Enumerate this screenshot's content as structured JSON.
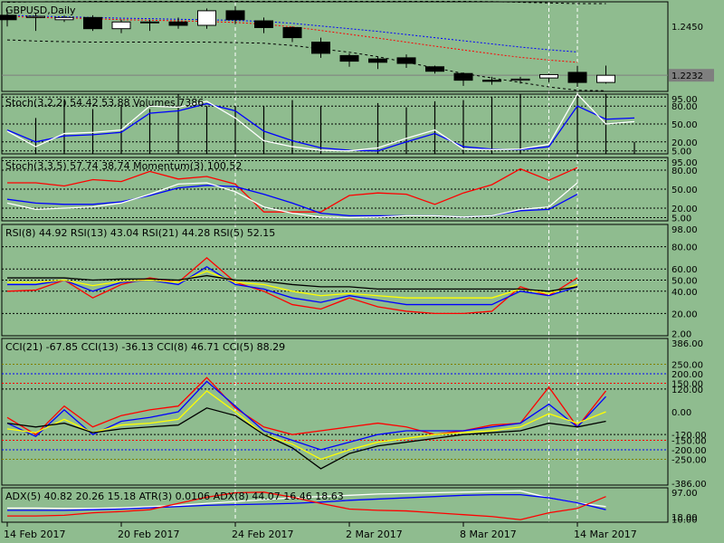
{
  "window": {
    "symbol_label": "GBPUSD,Daily",
    "last_price_label": "1.2232"
  },
  "x_labels": [
    {
      "bar": 0,
      "text": "14 Feb 2017"
    },
    {
      "bar": 4,
      "text": "20 Feb 2017"
    },
    {
      "bar": 8,
      "text": "24 Feb 2017"
    },
    {
      "bar": 12,
      "text": "2 Mar 2017"
    },
    {
      "bar": 16,
      "text": "8 Mar 2017"
    },
    {
      "bar": 20,
      "text": "14 Mar 2017"
    }
  ],
  "vlines_bars": [
    8,
    19,
    20
  ],
  "colors": {
    "background": "#8fbc8f",
    "bull": "#ffffff",
    "bear": "#000000",
    "red": "#ff0000",
    "blue": "#0000ff",
    "white": "#ffffff",
    "yellow": "#ffff00",
    "black": "#000000"
  },
  "chart_data": [
    {
      "type": "candlestick",
      "panel": "price",
      "ylim": [
        1.216,
        1.256
      ],
      "yticks": [
        "1.2450",
        "1.2232"
      ],
      "ohlc": [
        [
          1.25,
          1.2525,
          1.245,
          1.248
        ],
        [
          1.249,
          1.251,
          1.243,
          1.2495
        ],
        [
          1.248,
          1.25,
          1.247,
          1.249
        ],
        [
          1.249,
          1.25,
          1.243,
          1.244
        ],
        [
          1.244,
          1.248,
          1.242,
          1.247
        ],
        [
          1.247,
          1.248,
          1.243,
          1.247
        ],
        [
          1.247,
          1.249,
          1.244,
          1.2455
        ],
        [
          1.2455,
          1.253,
          1.244,
          1.252
        ],
        [
          1.252,
          1.254,
          1.246,
          1.248
        ],
        [
          1.2475,
          1.249,
          1.242,
          1.2445
        ],
        [
          1.2445,
          1.245,
          1.238,
          1.24
        ],
        [
          1.238,
          1.24,
          1.231,
          1.233
        ],
        [
          1.232,
          1.233,
          1.227,
          1.2295
        ],
        [
          1.2305,
          1.2315,
          1.226,
          1.229
        ],
        [
          1.231,
          1.2325,
          1.2265,
          1.2285
        ],
        [
          1.227,
          1.2275,
          1.224,
          1.225
        ],
        [
          1.224,
          1.2245,
          1.2185,
          1.221
        ],
        [
          1.221,
          1.2225,
          1.219,
          1.2205
        ],
        [
          1.221,
          1.2225,
          1.2195,
          1.2215
        ],
        [
          1.222,
          1.224,
          1.22,
          1.2235
        ],
        [
          1.2245,
          1.2275,
          1.218,
          1.22
        ],
        [
          1.22,
          1.2275,
          1.2195,
          1.2232
        ]
      ],
      "upper_band": [
        1.2558,
        1.256,
        1.2561,
        1.2562,
        1.2562,
        1.2562,
        1.2562,
        1.2562,
        1.2562,
        1.2562,
        1.2562,
        1.2562,
        1.2562,
        1.2562,
        1.2562,
        1.2562,
        1.2562,
        1.2561,
        1.2558,
        1.2555,
        1.2552,
        1.2552
      ],
      "lower_band": [
        1.239,
        1.2385,
        1.2382,
        1.238,
        1.238,
        1.238,
        1.238,
        1.238,
        1.2378,
        1.2375,
        1.2365,
        1.235,
        1.2335,
        1.2315,
        1.229,
        1.2265,
        1.224,
        1.222,
        1.22,
        1.218,
        1.2165,
        1.2163
      ],
      "red_ma": [
        1.2495,
        1.249,
        1.2488,
        1.2485,
        1.248,
        1.2478,
        1.2475,
        1.2472,
        1.2468,
        1.246,
        1.2448,
        1.2432,
        1.2415,
        1.2398,
        1.238,
        1.2362,
        1.2345,
        1.2328,
        1.2312,
        1.23,
        1.229
      ],
      "blue_ma": [
        1.25,
        1.2496,
        1.2493,
        1.249,
        1.2487,
        1.2485,
        1.2482,
        1.248,
        1.2477,
        1.2472,
        1.2464,
        1.2452,
        1.244,
        1.2428,
        1.2414,
        1.24,
        1.2386,
        1.2372,
        1.2358,
        1.2346,
        1.2336
      ],
      "current_price": 1.2232
    },
    {
      "type": "line",
      "panel": "stoch_volume",
      "title": "Stoch(3,2,2) 54.42 53.88 Volumes 7386",
      "ylim": [
        0,
        100
      ],
      "yticks": [
        "95.00",
        "80.00",
        "50.00",
        "20.00",
        "5.00"
      ],
      "levels": [
        95,
        80,
        50,
        20,
        5
      ],
      "series": [
        {
          "color": "blue",
          "values": [
            40,
            20,
            30,
            32,
            36,
            68,
            72,
            84,
            72,
            38,
            22,
            10,
            6,
            5,
            20,
            34,
            12,
            8,
            7,
            12,
            80,
            58,
            60
          ]
        },
        {
          "color": "white",
          "values": [
            38,
            12,
            34,
            36,
            40,
            80,
            78,
            88,
            60,
            22,
            12,
            6,
            5,
            10,
            26,
            40,
            8,
            7,
            8,
            16,
            100,
            50,
            54
          ]
        }
      ],
      "volume_bars": [
        0,
        60,
        90,
        75,
        80,
        75,
        100,
        80,
        80,
        80,
        90,
        80,
        0,
        85,
        78,
        88,
        90,
        95,
        100,
        0,
        100,
        100,
        20
      ]
    },
    {
      "type": "line",
      "panel": "stoch_momentum",
      "title": "Stoch(3,3,5) 57.74 38.74 Momentum(3) 100.52",
      "ylim": [
        0,
        100
      ],
      "yticks": [
        "95.00",
        "80.00",
        "50.00",
        "20.00",
        "5.00"
      ],
      "levels": [
        95,
        80,
        50,
        20,
        5
      ],
      "series": [
        {
          "color": "red",
          "values": [
            60,
            60,
            55,
            65,
            62,
            78,
            66,
            70,
            58,
            14,
            14,
            14,
            40,
            44,
            42,
            26,
            44,
            57,
            82,
            64,
            84
          ]
        },
        {
          "color": "blue",
          "values": [
            34,
            28,
            26,
            26,
            30,
            40,
            52,
            56,
            54,
            42,
            28,
            12,
            8,
            8,
            8,
            8,
            6,
            8,
            16,
            18,
            42
          ]
        },
        {
          "color": "white",
          "values": [
            28,
            18,
            20,
            22,
            28,
            42,
            58,
            60,
            46,
            22,
            12,
            6,
            5,
            6,
            8,
            8,
            6,
            8,
            18,
            22,
            60
          ]
        }
      ]
    },
    {
      "type": "line",
      "panel": "rsi",
      "title": "RSI(8) 44.92 RSI(13) 43.04 RSI(21) 44.28 RSI(5) 52.15",
      "ylim": [
        0,
        100
      ],
      "yticks": [
        "98.00",
        "80.00",
        "60.00",
        "50.00",
        "40.00",
        "20.00",
        "2.00"
      ],
      "levels": [
        80,
        60,
        50,
        40,
        20
      ],
      "series": [
        {
          "color": "red",
          "values": [
            40,
            41,
            50,
            34,
            46,
            52,
            48,
            70,
            48,
            40,
            28,
            24,
            34,
            26,
            22,
            20,
            20,
            22,
            44,
            36,
            52
          ]
        },
        {
          "color": "blue",
          "values": [
            46,
            46,
            50,
            40,
            48,
            50,
            46,
            62,
            46,
            42,
            34,
            30,
            36,
            32,
            28,
            28,
            28,
            28,
            40,
            36,
            44
          ]
        },
        {
          "color": "yellow",
          "values": [
            48,
            48,
            50,
            45,
            49,
            50,
            48,
            58,
            48,
            46,
            40,
            36,
            38,
            36,
            34,
            34,
            34,
            34,
            42,
            38,
            46
          ]
        },
        {
          "color": "black",
          "values": [
            52,
            52,
            52,
            50,
            51,
            51,
            50,
            54,
            50,
            49,
            46,
            44,
            44,
            42,
            42,
            42,
            42,
            42,
            42,
            40,
            44
          ]
        }
      ]
    },
    {
      "type": "line",
      "panel": "cci",
      "title": "CCI(21) -67.85 CCI(13) -36.13 CCI(8) 46.71 CCI(5) 88.29",
      "ylim": [
        -386,
        386
      ],
      "yticks": [
        "386.00",
        "250.00",
        "200.00",
        "150.00",
        "120.00",
        "0.00",
        "-120.00",
        "-150.00",
        "-200.00",
        "-250.00",
        "-386.00"
      ],
      "levels": [
        250,
        200,
        150,
        120,
        -120,
        -150,
        -200,
        -250
      ],
      "series": [
        {
          "color": "red",
          "values": [
            -30,
            -120,
            30,
            -80,
            -20,
            10,
            30,
            180,
            20,
            -80,
            -120,
            -100,
            -80,
            -60,
            -80,
            -120,
            -100,
            -70,
            -60,
            130,
            -80,
            110
          ]
        },
        {
          "color": "blue",
          "values": [
            -60,
            -130,
            10,
            -120,
            -50,
            -30,
            0,
            160,
            30,
            -100,
            -150,
            -200,
            -160,
            -120,
            -100,
            -100,
            -100,
            -80,
            -60,
            40,
            -80,
            80
          ]
        },
        {
          "color": "yellow",
          "values": [
            -90,
            -110,
            -40,
            -110,
            -70,
            -60,
            -40,
            110,
            0,
            -120,
            -170,
            -250,
            -200,
            -160,
            -140,
            -120,
            -110,
            -100,
            -80,
            -10,
            -60,
            0
          ]
        },
        {
          "color": "black",
          "values": [
            -60,
            -80,
            -60,
            -110,
            -90,
            -80,
            -70,
            20,
            -20,
            -120,
            -190,
            -300,
            -220,
            -180,
            -160,
            -140,
            -120,
            -110,
            -100,
            -60,
            -80,
            -50
          ]
        }
      ]
    },
    {
      "type": "line",
      "panel": "adx_atr",
      "title": "ADX(5) 40.82 20.26 15.18 ATR(3) 0.0106 ADX(8) 44.07 16.46 18.63",
      "ylim": [
        0,
        110
      ],
      "yticks": [
        "97.00",
        "18.00",
        "10.00"
      ],
      "series": [
        {
          "color": "white",
          "values": [
            45,
            45,
            44,
            44,
            46,
            50,
            54,
            60,
            66,
            72,
            78,
            82,
            86,
            90,
            92,
            94,
            96,
            98,
            100,
            78,
            62,
            50
          ]
        },
        {
          "color": "blue",
          "values": [
            38,
            38,
            38,
            40,
            42,
            46,
            50,
            54,
            56,
            58,
            60,
            64,
            70,
            74,
            78,
            82,
            86,
            88,
            88,
            78,
            62,
            40
          ]
        },
        {
          "color": "red",
          "values": [
            20,
            20,
            22,
            30,
            34,
            40,
            60,
            80,
            94,
            96,
            80,
            60,
            42,
            38,
            36,
            30,
            24,
            18,
            8,
            30,
            44,
            82
          ]
        }
      ]
    }
  ]
}
